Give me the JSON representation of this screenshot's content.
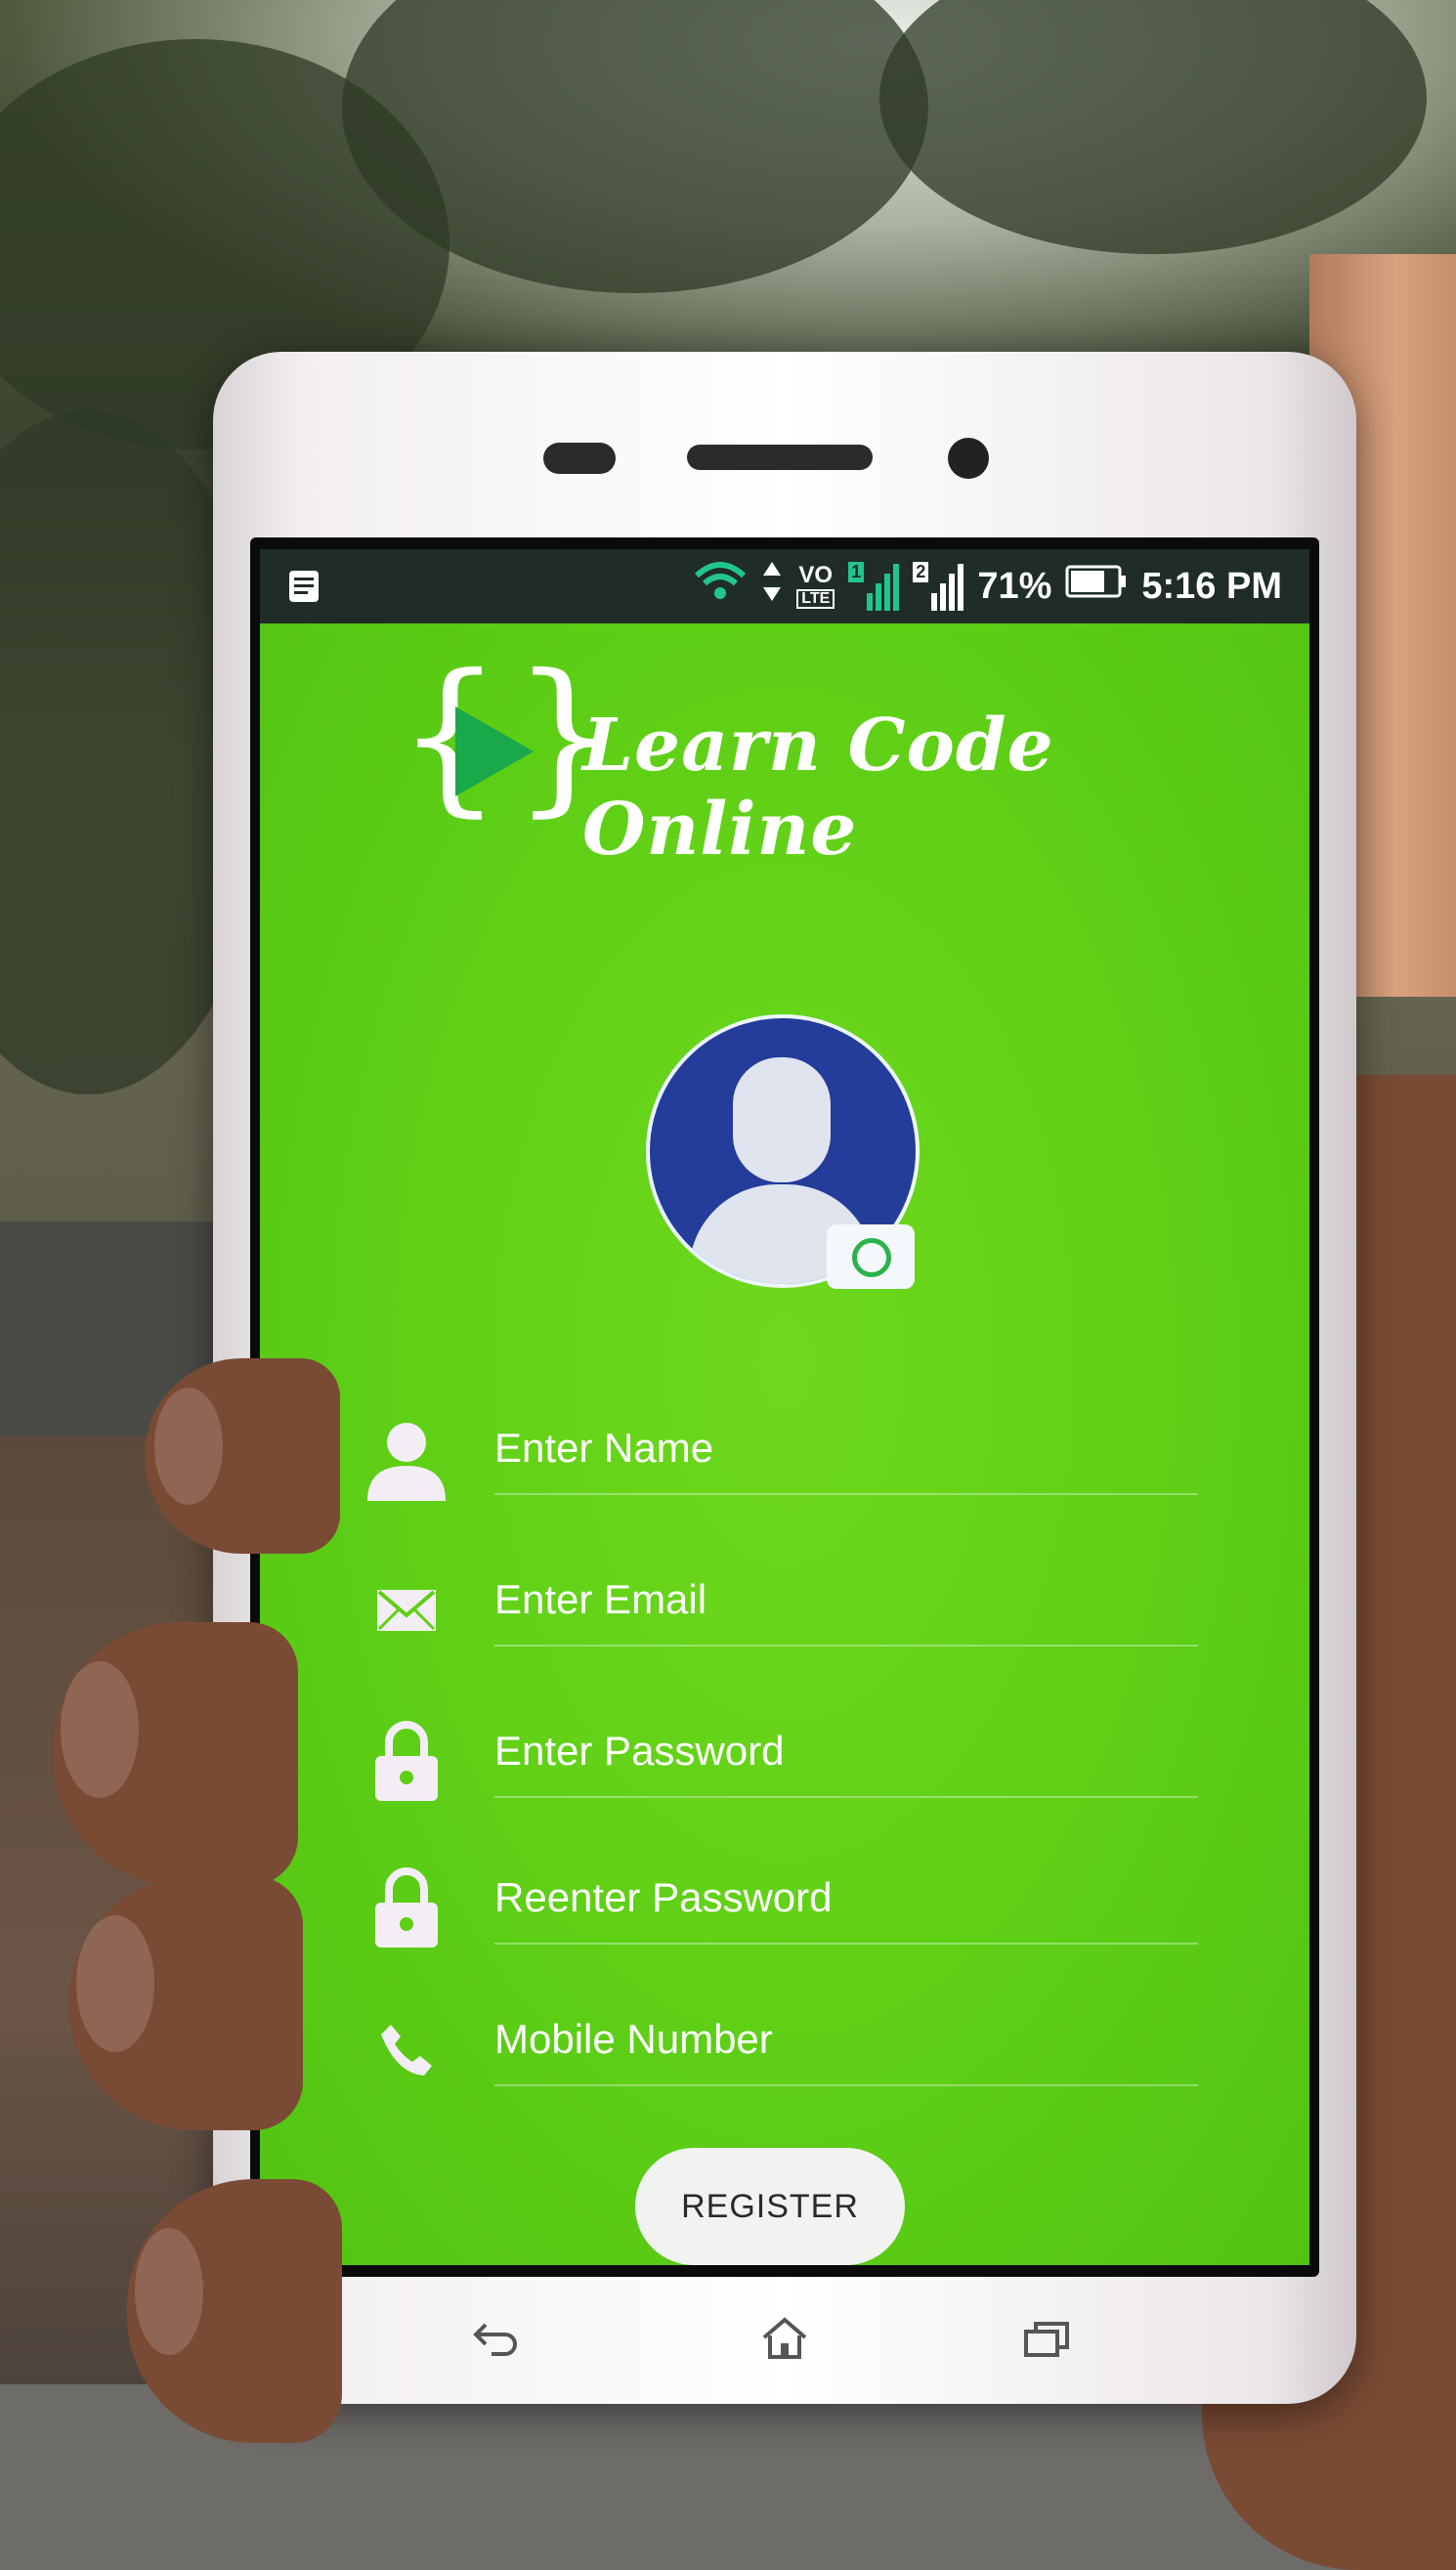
{
  "statusbar": {
    "battery_percent": "71%",
    "time": "5:16 PM",
    "network_badge": "VO",
    "network_sub": "LTE",
    "sim1": "1",
    "sim2": "2",
    "icons": [
      "notes-icon",
      "wifi-icon",
      "data-arrows-icon",
      "signal-sim1-icon",
      "signal-sim2-icon",
      "battery-icon"
    ]
  },
  "app": {
    "logo_text": "Learn Code Online",
    "logo_left_brace": "{",
    "logo_right_brace": "}",
    "avatar_icon": "user-avatar-icon",
    "avatar_action_icon": "camera-rotate-icon",
    "fields": [
      {
        "placeholder": "Enter Name",
        "icon": "person-icon"
      },
      {
        "placeholder": "Enter Email",
        "icon": "envelope-icon"
      },
      {
        "placeholder": "Enter Password",
        "icon": "lock-icon"
      },
      {
        "placeholder": "Reenter Password",
        "icon": "lock-icon"
      },
      {
        "placeholder": "Mobile Number",
        "icon": "phone-icon"
      }
    ],
    "register_label": "REGISTER"
  },
  "navigation": {
    "buttons": [
      "back-icon",
      "home-icon",
      "recents-icon"
    ]
  },
  "colors": {
    "app_background": "#5ecf16",
    "statusbar": "#1f2d26",
    "avatar_background": "#243c9a",
    "text": "#ffffff"
  }
}
